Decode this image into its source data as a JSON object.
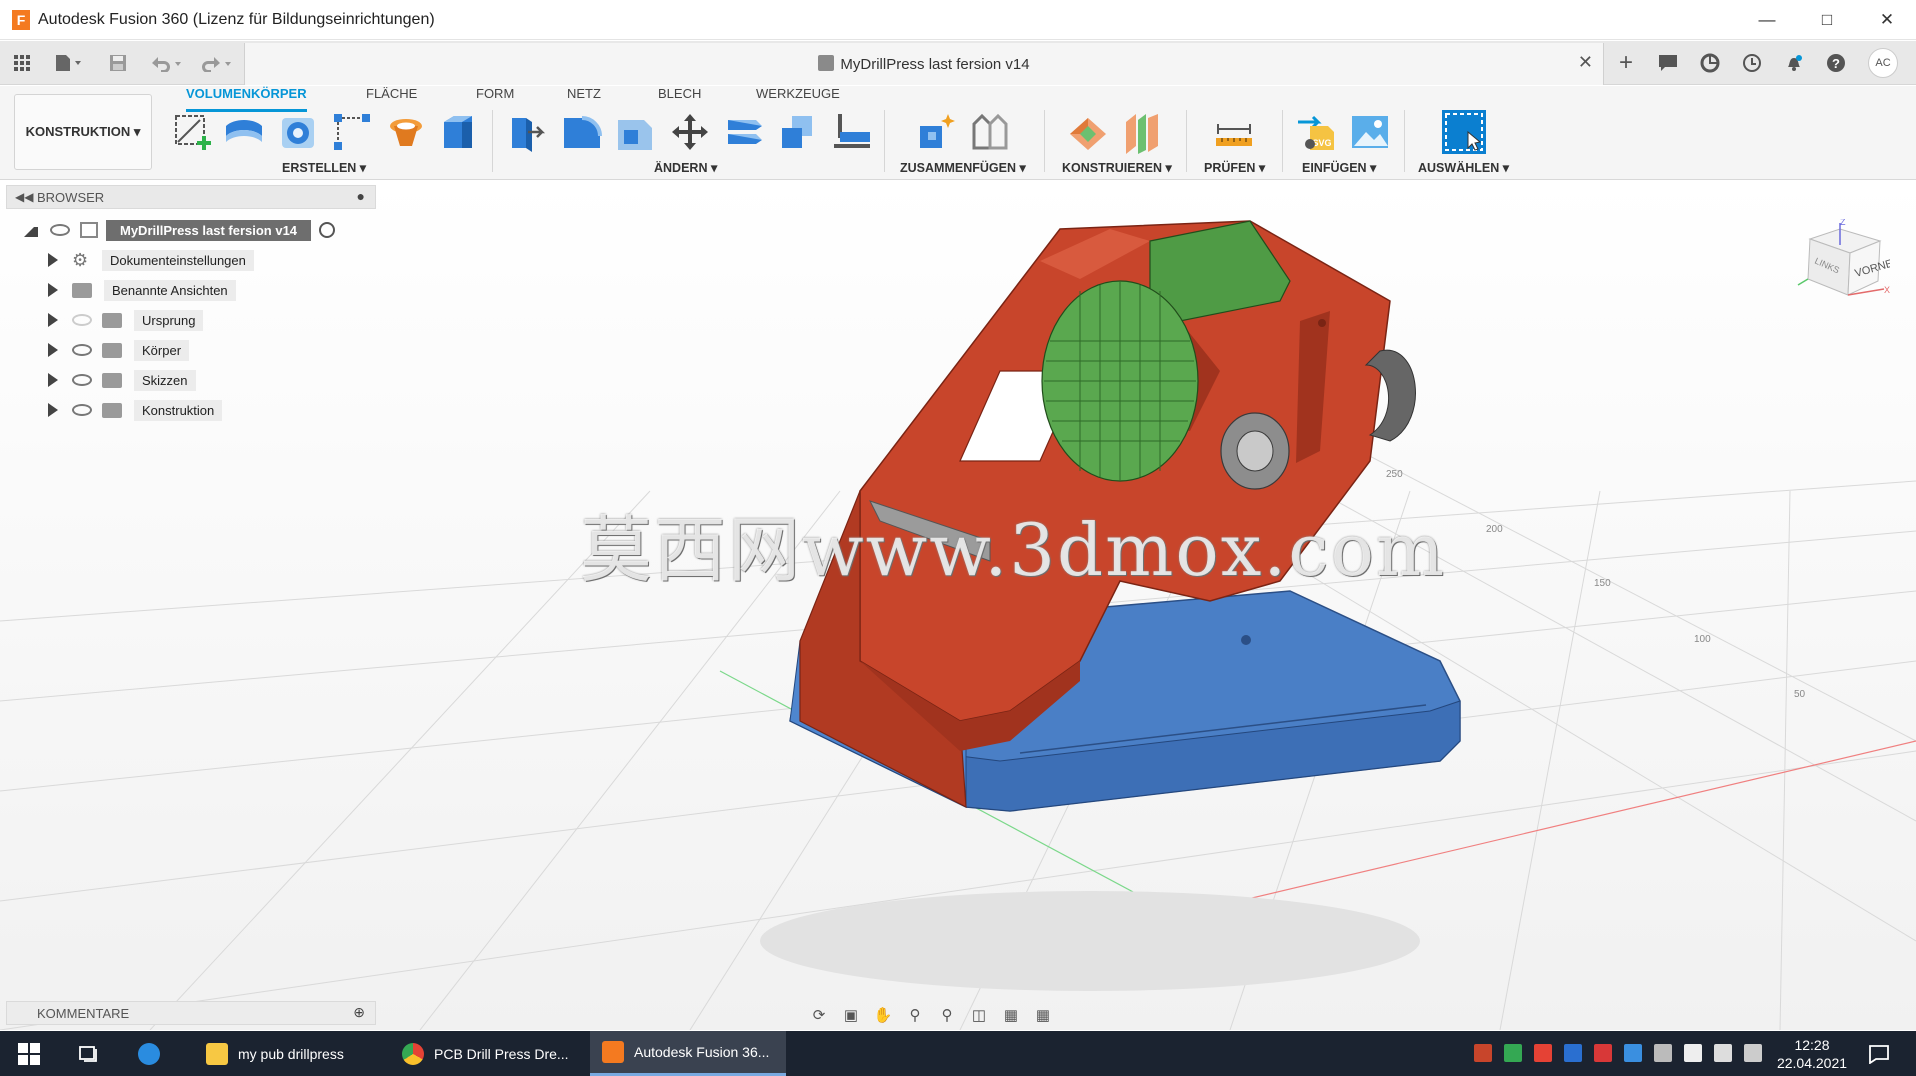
{
  "window": {
    "title": "Autodesk Fusion 360 (Lizenz für Bildungseinrichtungen)"
  },
  "document": {
    "tab_title": "MyDrillPress last fersion v14"
  },
  "user": {
    "initials": "AC"
  },
  "workspace": {
    "label": "KONSTRUKTION ▾"
  },
  "tabs": [
    "VOLUMENKÖRPER",
    "FLÄCHE",
    "FORM",
    "NETZ",
    "BLECH",
    "WERKZEUGE"
  ],
  "groups": {
    "erstellen": "ERSTELLEN ▾",
    "aendern": "ÄNDERN ▾",
    "zusammenfuegen": "ZUSAMMENFÜGEN ▾",
    "konstruieren": "KONSTRUIEREN ▾",
    "pruefen": "PRÜFEN ▾",
    "einfuegen": "EINFÜGEN ▾",
    "auswaehlen": "AUSWÄHLEN ▾"
  },
  "browser": {
    "title": "BROWSER",
    "root": "MyDrillPress last fersion v14",
    "items": [
      "Dokumenteinstellungen",
      "Benannte Ansichten",
      "Ursprung",
      "Körper",
      "Skizzen",
      "Konstruktion"
    ]
  },
  "comments": {
    "title": "KOMMENTARE"
  },
  "viewcube": {
    "front": "VORNE",
    "left": "LINKS"
  },
  "watermark": "莫西网www.3dmox.com",
  "grid_labels": [
    "250",
    "200",
    "150",
    "100",
    "50"
  ],
  "taskbar": {
    "items": [
      "my pub drillpress",
      "PCB Drill Press Dre...",
      "Autodesk Fusion 36..."
    ],
    "time": "12:28",
    "date": "22.04.2021"
  },
  "colors": {
    "accent": "#0696d7",
    "frame_red": "#c8452b",
    "motor_green": "#4f9b45",
    "base_blue": "#3d6fb6"
  }
}
